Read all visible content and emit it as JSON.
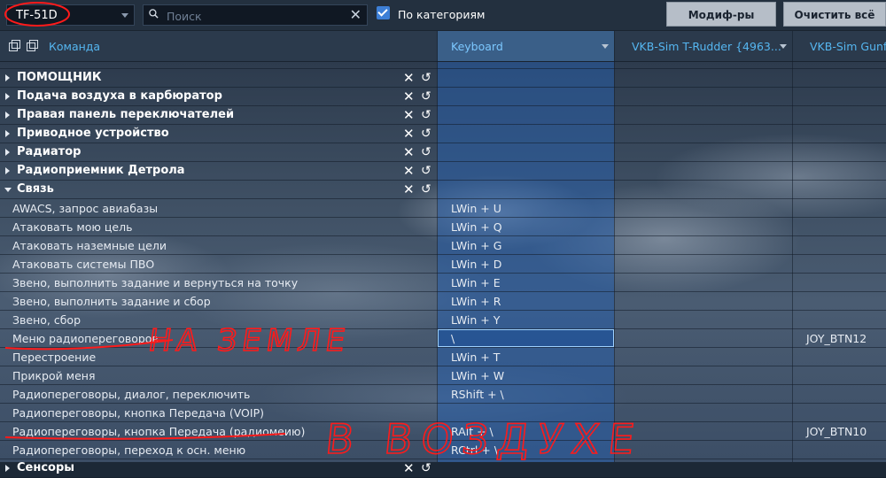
{
  "toolbar": {
    "aircraft_select": "TF-51D",
    "search_placeholder": "Поиск",
    "category_checkbox_label": "По категориям",
    "modifiers_button": "Модиф-ры",
    "clear_all_button": "Очистить всё"
  },
  "columns": {
    "command": "Команда",
    "keyboard": "Keyboard",
    "rudder": "VKB-Sim T-Rudder  {4963...",
    "gunfighter": "VKB-Sim Gunfig"
  },
  "categories": [
    {
      "label": "ПОМОЩНИК"
    },
    {
      "label": "Подача воздуха в карбюратор"
    },
    {
      "label": "Правая панель переключателей"
    },
    {
      "label": "Приводное устройство"
    },
    {
      "label": "Радиатор"
    },
    {
      "label": "Радиоприемник Детрола"
    },
    {
      "label": "Связь"
    }
  ],
  "rows": [
    {
      "name": "AWACS, запрос авиабазы",
      "keyboard": "LWin + U",
      "gunfighter": ""
    },
    {
      "name": "Атаковать мою цель",
      "keyboard": "LWin + Q",
      "gunfighter": ""
    },
    {
      "name": "Атаковать наземные цели",
      "keyboard": "LWin + G",
      "gunfighter": ""
    },
    {
      "name": "Атаковать системы ПВО",
      "keyboard": "LWin + D",
      "gunfighter": ""
    },
    {
      "name": "Звено, выполнить задание и вернуться на точку",
      "keyboard": "LWin + E",
      "gunfighter": ""
    },
    {
      "name": "Звено, выполнить задание и сбор",
      "keyboard": "LWin + R",
      "gunfighter": ""
    },
    {
      "name": "Звено, сбор",
      "keyboard": "LWin + Y",
      "gunfighter": ""
    },
    {
      "name": "Меню радиопереговоров",
      "keyboard": "\\",
      "gunfighter": "JOY_BTN12"
    },
    {
      "name": "Перестроение",
      "keyboard": "LWin + T",
      "gunfighter": ""
    },
    {
      "name": "Прикрой меня",
      "keyboard": "LWin + W",
      "gunfighter": ""
    },
    {
      "name": "Радиопереговоры, диалог, переключить",
      "keyboard": "RShift + \\",
      "gunfighter": ""
    },
    {
      "name": "Радиопереговоры, кнопка Передача (VOIP)",
      "keyboard": "",
      "gunfighter": ""
    },
    {
      "name": "Радиопереговоры, кнопка Передача (радиомеию)",
      "keyboard": "RAlt + \\",
      "gunfighter": "JOY_BTN10"
    },
    {
      "name": "Радиопереговоры, переход к осн. меню",
      "keyboard": "RCtrl + \\",
      "gunfighter": ""
    },
    {
      "name": "Сенсоры",
      "keyboard": "",
      "gunfighter": ""
    }
  ],
  "annotations": {
    "on_ground": "НА ЗЕМЛЕ",
    "in_air": "В ВОЗДУХЕ"
  },
  "colors": {
    "accent": "#55b6f0",
    "annotation_ink": "#ff1a1a",
    "keyboard_column": "#2f64a8"
  }
}
